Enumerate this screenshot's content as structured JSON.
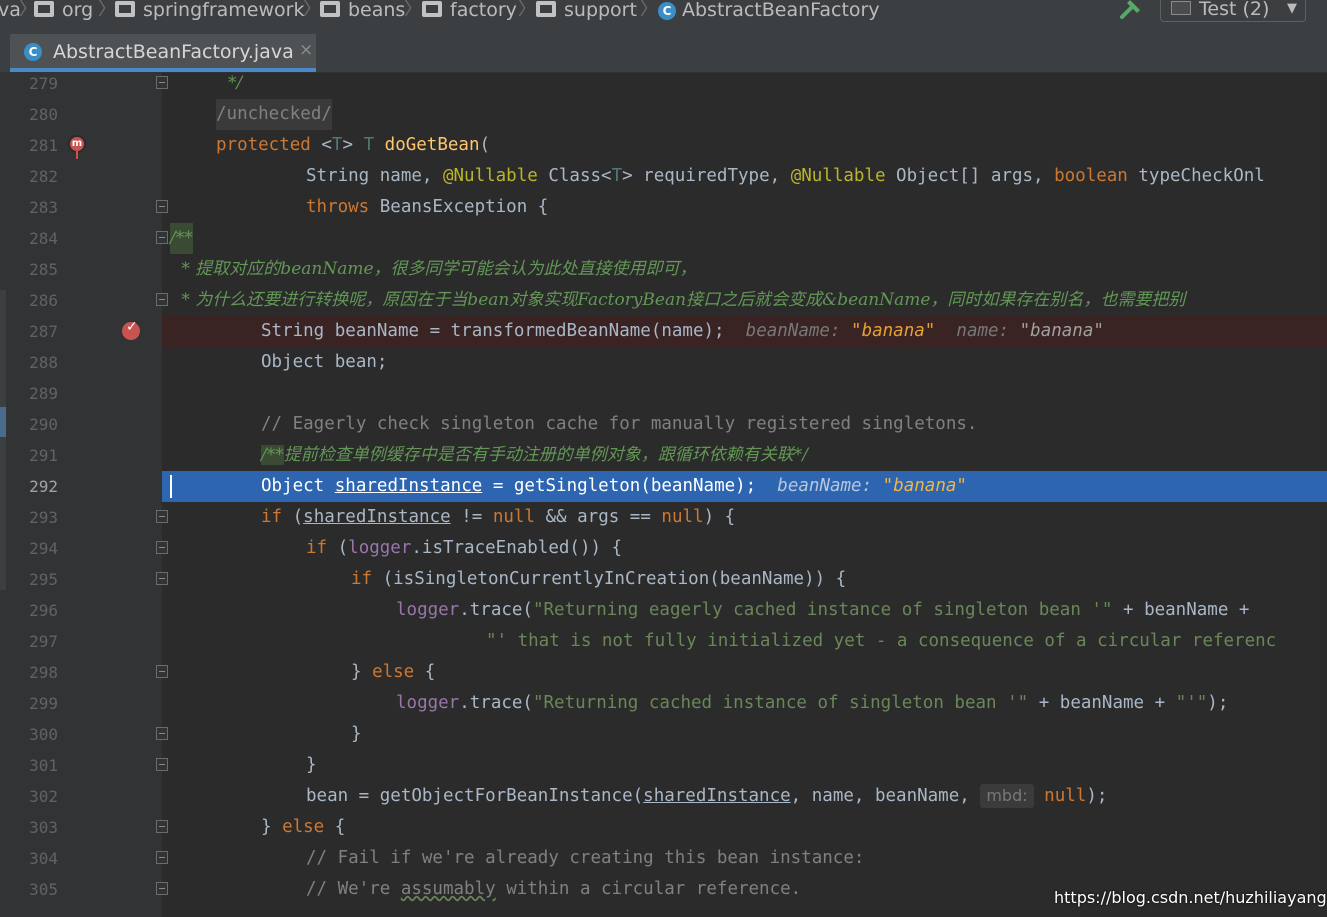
{
  "breadcrumbs": [
    "va",
    "org",
    "springframework",
    "beans",
    "factory",
    "support",
    "AbstractBeanFactory"
  ],
  "run_config": {
    "label": "Test (2)"
  },
  "tab": {
    "title": "AbstractBeanFactory.java",
    "close": "×"
  },
  "line_numbers": [
    "279",
    "280",
    "281",
    "282",
    "283",
    "284",
    "285",
    "286",
    "287",
    "288",
    "289",
    "290",
    "291",
    "292",
    "293",
    "294",
    "295",
    "296",
    "297",
    "298",
    "299",
    "300",
    "301",
    "302",
    "303",
    "304",
    "305"
  ],
  "current_line": "292",
  "code": {
    "l279": "*/",
    "l280": "/unchecked/",
    "l281": {
      "kw": "protected",
      "tp1": "<",
      "tp2": "T",
      "tp3": ">",
      "ret": "T",
      "name": "doGetBean",
      "paren": "("
    },
    "l282": {
      "t1": "String name, ",
      "a1": "@Nullable",
      "t2": " Class<",
      "tp": "T",
      "t3": "> requiredType, ",
      "a2": "@Nullable",
      "t4": " Object[] args, ",
      "kw": "boolean",
      "t5": " typeCheckOnl"
    },
    "l283": {
      "kw": "throws",
      "rest": " BeansException {"
    },
    "l284": "/**",
    "l285": " * 提取对应的beanName，很多同学可能会认为此处直接使用即可，",
    "l286": " * 为什么还要进行转换呢，原因在于当bean对象实现FactoryBean接口之后就会变成&beanName，同时如果存在别名，也需要把别",
    "l287": {
      "code": "String beanName = transformedBeanName(name);",
      "h1": "beanName: ",
      "v1": "\"banana\"",
      "h2": "name: ",
      "v2": "\"banana\""
    },
    "l288": {
      "code": "Object bean;"
    },
    "l290": "// Eagerly check singleton cache for manually registered singletons.",
    "l291": {
      "open": "/**",
      "text": "提前检查单例缓存中是否有手动注册的单例对象，跟循环依赖有关联*/"
    },
    "l292": {
      "t1": "Object ",
      "var": "sharedInstance",
      "t2": " = getSingleton(beanName);",
      "h1": "beanName: ",
      "v1": "\"banana\""
    },
    "l293": {
      "kw1": "if",
      "t1": " (",
      "var": "sharedInstance",
      "t2": " != ",
      "kw2": "null",
      "t3": " && args == ",
      "kw3": "null",
      "t4": ") {"
    },
    "l294": {
      "kw": "if",
      "t1": " (",
      "fld": "logger",
      "t2": ".isTraceEnabled()) {"
    },
    "l295": {
      "kw": "if",
      "t1": " (isSingletonCurrentlyInCreation(beanName)) {"
    },
    "l296": {
      "fld": "logger",
      "t1": ".trace(",
      "str": "\"Returning eagerly cached instance of singleton bean '\"",
      "t2": " + beanName +"
    },
    "l297": {
      "str": "\"' that is not fully initialized yet - a consequence of a circular referenc"
    },
    "l298": {
      "t1": "} ",
      "kw": "else",
      "t2": " {"
    },
    "l299": {
      "fld": "logger",
      "t1": ".trace(",
      "str1": "\"Returning cached instance of singleton bean '\"",
      "t2": " + beanName + ",
      "str2": "\"'\"",
      "t3": ");"
    },
    "l300": "}",
    "l301": "}",
    "l302": {
      "t1": "bean = getObjectForBeanInstance(",
      "var": "sharedInstance",
      "t2": ", name, beanName, ",
      "hint": "mbd:",
      "kw": "null",
      "t3": ");"
    },
    "l303": {
      "t1": "} ",
      "kw": "else",
      "t2": " {"
    },
    "l304": "// Fail if we're already creating this bean instance:",
    "l305": {
      "t1": "// We're ",
      "ul": "assumably",
      "t2": " within a circular reference."
    }
  },
  "watermark": "https://blog.csdn.net/huzhiliayanghao",
  "colors": {
    "background": "#2b2b2b",
    "keyword": "#cc7832",
    "annotation": "#bbb529",
    "string": "#6a8759",
    "doc_comment": "#629755",
    "field": "#9876aa",
    "method": "#ffc66d",
    "execution_line": "#2d65b0",
    "breakpoint_line": "#3a2323"
  },
  "icons": [
    "folder-icon",
    "class-icon",
    "hammer-icon",
    "run-config-icon",
    "close-icon",
    "breakpoint-icon",
    "override-icon",
    "fold-marker-icon"
  ]
}
